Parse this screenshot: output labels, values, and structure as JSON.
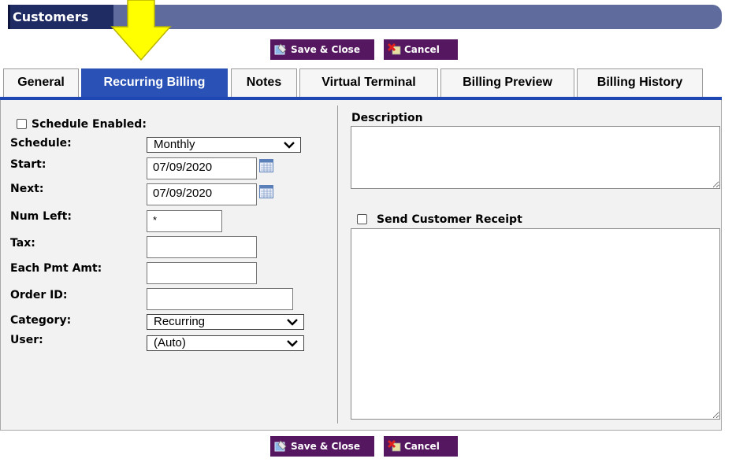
{
  "header": {
    "title": "Customers"
  },
  "toolbar": {
    "save_close": "Save & Close",
    "cancel": "Cancel"
  },
  "tabs": [
    {
      "label": "General"
    },
    {
      "label": "Recurring Billing"
    },
    {
      "label": "Notes"
    },
    {
      "label": "Virtual Terminal"
    },
    {
      "label": "Billing Preview"
    },
    {
      "label": "Billing History"
    }
  ],
  "form": {
    "schedule_enabled": {
      "label": "Schedule Enabled:",
      "checked": false
    },
    "schedule": {
      "label": "Schedule:",
      "value": "Monthly"
    },
    "start": {
      "label": "Start:",
      "value": "07/09/2020"
    },
    "next": {
      "label": "Next:",
      "value": "07/09/2020"
    },
    "num_left": {
      "label": "Num Left:",
      "value": "*"
    },
    "tax": {
      "label": "Tax:",
      "value": ""
    },
    "each_pmt_amt": {
      "label": "Each Pmt Amt:",
      "value": ""
    },
    "order_id": {
      "label": "Order ID:",
      "value": ""
    },
    "category": {
      "label": "Category:",
      "value": "Recurring"
    },
    "user": {
      "label": "User:",
      "value": "(Auto)"
    }
  },
  "right": {
    "description_label": "Description",
    "send_receipt": {
      "label": "Send Customer Receipt",
      "checked": false
    }
  },
  "colors": {
    "header_bar": "#5e6b9c",
    "header_dark": "#1f2b63",
    "active_tab": "#2a51b5",
    "button": "#55175f",
    "highlight_arrow": "#ffff00"
  },
  "icons": {
    "save": "save-disk-icon",
    "cancel": "cancel-x-icon",
    "calendar": "calendar-icon",
    "arrow": "yellow-down-arrow"
  }
}
